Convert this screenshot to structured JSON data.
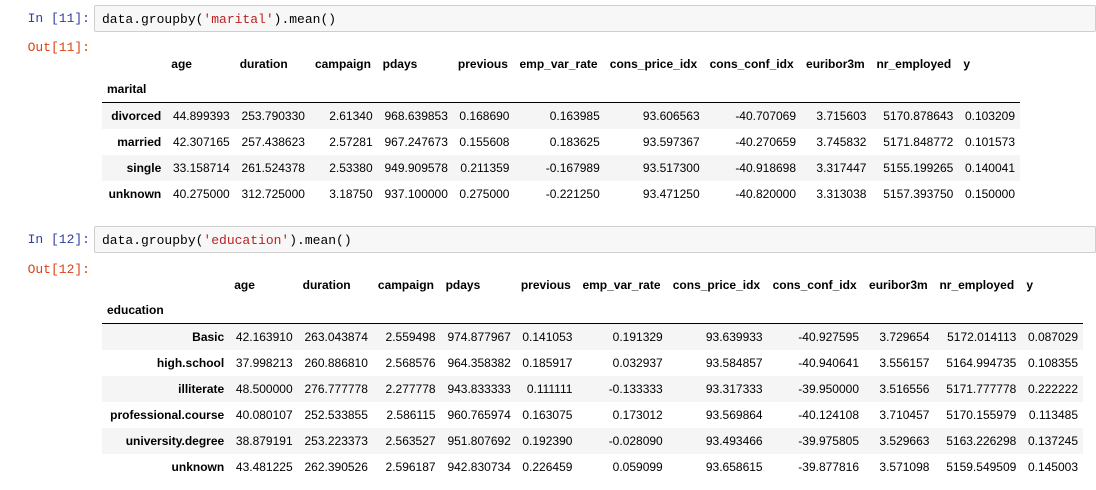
{
  "cell1": {
    "in_prompt": "In [11]:",
    "code_prefix": "data.groupby(",
    "code_str": "'marital'",
    "code_suffix": ").mean()",
    "out_prompt": "Out[11]:",
    "index_name": "marital",
    "columns": [
      "age",
      "duration",
      "campaign",
      "pdays",
      "previous",
      "emp_var_rate",
      "cons_price_idx",
      "cons_conf_idx",
      "euribor3m",
      "nr_employed",
      "y"
    ],
    "rows": [
      {
        "index": "divorced",
        "values": [
          "44.899393",
          "253.790330",
          "2.61340",
          "968.639853",
          "0.168690",
          "0.163985",
          "93.606563",
          "-40.707069",
          "3.715603",
          "5170.878643",
          "0.103209"
        ]
      },
      {
        "index": "married",
        "values": [
          "42.307165",
          "257.438623",
          "2.57281",
          "967.247673",
          "0.155608",
          "0.183625",
          "93.597367",
          "-40.270659",
          "3.745832",
          "5171.848772",
          "0.101573"
        ]
      },
      {
        "index": "single",
        "values": [
          "33.158714",
          "261.524378",
          "2.53380",
          "949.909578",
          "0.211359",
          "-0.167989",
          "93.517300",
          "-40.918698",
          "3.317447",
          "5155.199265",
          "0.140041"
        ]
      },
      {
        "index": "unknown",
        "values": [
          "40.275000",
          "312.725000",
          "3.18750",
          "937.100000",
          "0.275000",
          "-0.221250",
          "93.471250",
          "-40.820000",
          "3.313038",
          "5157.393750",
          "0.150000"
        ]
      }
    ]
  },
  "cell2": {
    "in_prompt": "In [12]:",
    "code_prefix": "data.groupby(",
    "code_str": "'education'",
    "code_suffix": ").mean()",
    "out_prompt": "Out[12]:",
    "index_name": "education",
    "columns": [
      "age",
      "duration",
      "campaign",
      "pdays",
      "previous",
      "emp_var_rate",
      "cons_price_idx",
      "cons_conf_idx",
      "euribor3m",
      "nr_employed",
      "y"
    ],
    "rows": [
      {
        "index": "Basic",
        "values": [
          "42.163910",
          "263.043874",
          "2.559498",
          "974.877967",
          "0.141053",
          "0.191329",
          "93.639933",
          "-40.927595",
          "3.729654",
          "5172.014113",
          "0.087029"
        ]
      },
      {
        "index": "high.school",
        "values": [
          "37.998213",
          "260.886810",
          "2.568576",
          "964.358382",
          "0.185917",
          "0.032937",
          "93.584857",
          "-40.940641",
          "3.556157",
          "5164.994735",
          "0.108355"
        ]
      },
      {
        "index": "illiterate",
        "values": [
          "48.500000",
          "276.777778",
          "2.277778",
          "943.833333",
          "0.111111",
          "-0.133333",
          "93.317333",
          "-39.950000",
          "3.516556",
          "5171.777778",
          "0.222222"
        ]
      },
      {
        "index": "professional.course",
        "values": [
          "40.080107",
          "252.533855",
          "2.586115",
          "960.765974",
          "0.163075",
          "0.173012",
          "93.569864",
          "-40.124108",
          "3.710457",
          "5170.155979",
          "0.113485"
        ]
      },
      {
        "index": "university.degree",
        "values": [
          "38.879191",
          "253.223373",
          "2.563527",
          "951.807692",
          "0.192390",
          "-0.028090",
          "93.493466",
          "-39.975805",
          "3.529663",
          "5163.226298",
          "0.137245"
        ]
      },
      {
        "index": "unknown",
        "values": [
          "43.481225",
          "262.390526",
          "2.596187",
          "942.830734",
          "0.226459",
          "0.059099",
          "93.658615",
          "-39.877816",
          "3.571098",
          "5159.549509",
          "0.145003"
        ]
      }
    ]
  }
}
